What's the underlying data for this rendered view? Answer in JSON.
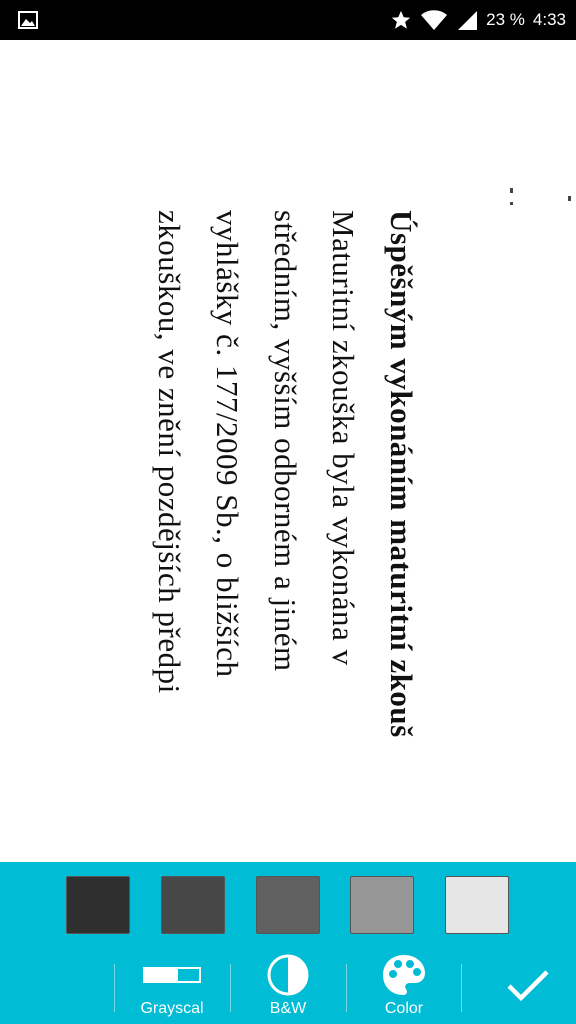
{
  "status_bar": {
    "battery_text": "23 %",
    "time": "4:33",
    "icons": [
      "gallery-icon",
      "star-icon",
      "wifi-icon",
      "signal-icon"
    ]
  },
  "document": {
    "lines": [
      "Úspěšným vykonáním maturitní zkouš",
      "Maturitní zkouška byla vykonána v",
      "středním, vyšším odborném a jiném",
      "vyhlášky č. 177/2009 Sb., o bližších",
      "zkouškou, ve znění pozdějších předpi"
    ]
  },
  "swatches": {
    "colors": [
      "#2f2f2f",
      "#474747",
      "#606060",
      "#969696",
      "#e6e6e6"
    ]
  },
  "tools": {
    "grayscale_label": "Grayscal",
    "bw_label": "B&W",
    "color_label": "Color"
  },
  "theme": {
    "accent": "#00bcd4",
    "status_bar_bg": "#000000"
  }
}
